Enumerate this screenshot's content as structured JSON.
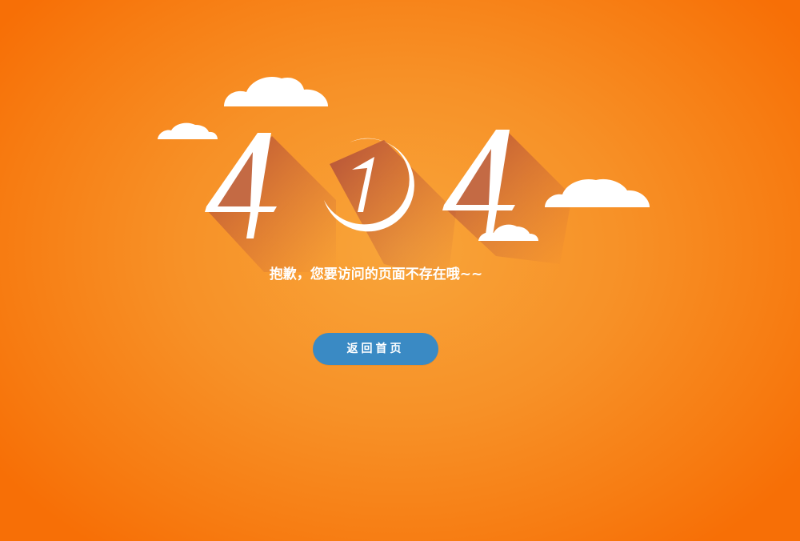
{
  "error_code_digits": [
    "4",
    "0",
    "4"
  ],
  "message": "抱歉，您要访问的页面不存在哦~~",
  "home_button": {
    "label": "返回首页"
  },
  "colors": {
    "background": "#f79127",
    "button": "#3a8ac4",
    "text": "#ffffff",
    "shadow": "#b9503a"
  }
}
